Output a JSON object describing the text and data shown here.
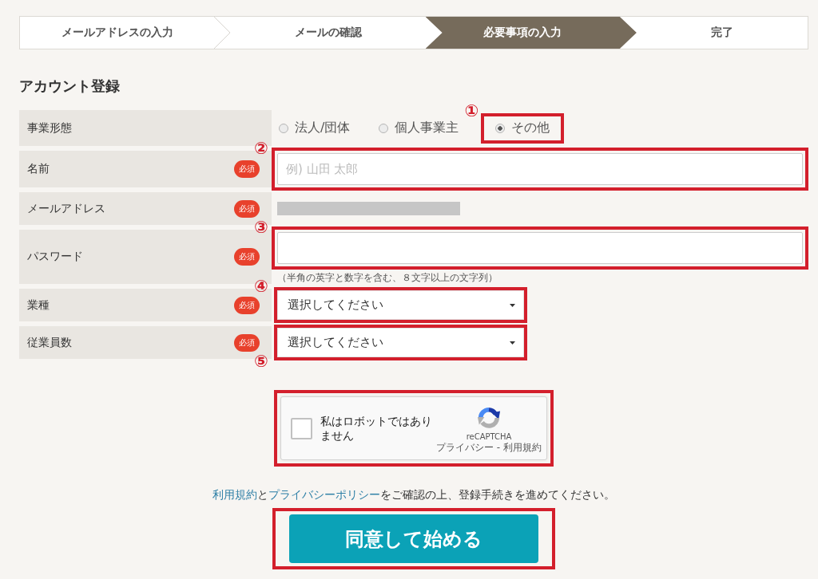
{
  "steps": [
    {
      "label": "メールアドレスの入力",
      "selected": false
    },
    {
      "label": "メールの確認",
      "selected": false
    },
    {
      "label": "必要事項の入力",
      "selected": true
    },
    {
      "label": "完了",
      "selected": false
    }
  ],
  "heading": "アカウント登録",
  "form": {
    "rows": [
      {
        "kind": "radio",
        "label": "事業形態",
        "options": [
          {
            "label": "法人/団体",
            "selected": false,
            "highlighted": false
          },
          {
            "label": "個人事業主",
            "selected": false,
            "highlighted": false
          },
          {
            "label": "その他",
            "selected": true,
            "highlighted": true,
            "marker": "①"
          }
        ]
      },
      {
        "kind": "text",
        "label": "名前",
        "badge": "必須",
        "placeholder": "例) 山田 太郎",
        "highlighted": true,
        "marker": "②"
      },
      {
        "kind": "redacted",
        "label": "メールアドレス",
        "badge": "必須",
        "highlighted": false
      },
      {
        "kind": "password",
        "label": "パスワード",
        "badge": "必須",
        "hint": "（半角の英字と数字を含む、８文字以上の文字列）",
        "highlighted": true,
        "marker": "③"
      },
      {
        "kind": "select",
        "label": "業種",
        "badge": "必須",
        "value": "選択してください",
        "highlighted": true,
        "marker": "④"
      },
      {
        "kind": "select",
        "label": "従業員数",
        "badge": "必須",
        "value": "選択してください",
        "highlighted": true,
        "marker": "⑤"
      }
    ]
  },
  "captcha": {
    "label": "私はロボットではありません",
    "checked": false,
    "brand": "reCAPTCHA",
    "footer": "プライバシー - 利用規約",
    "highlighted": true
  },
  "notice": [
    {
      "kind": "link",
      "text": "利用規約"
    },
    {
      "kind": "text",
      "text": "と"
    },
    {
      "kind": "link",
      "text": "プライバシーポリシー"
    },
    {
      "kind": "text",
      "text": "をご確認の上、登録手続きを進めてください。"
    }
  ],
  "submit": {
    "label": "同意して始める",
    "highlighted": true
  }
}
